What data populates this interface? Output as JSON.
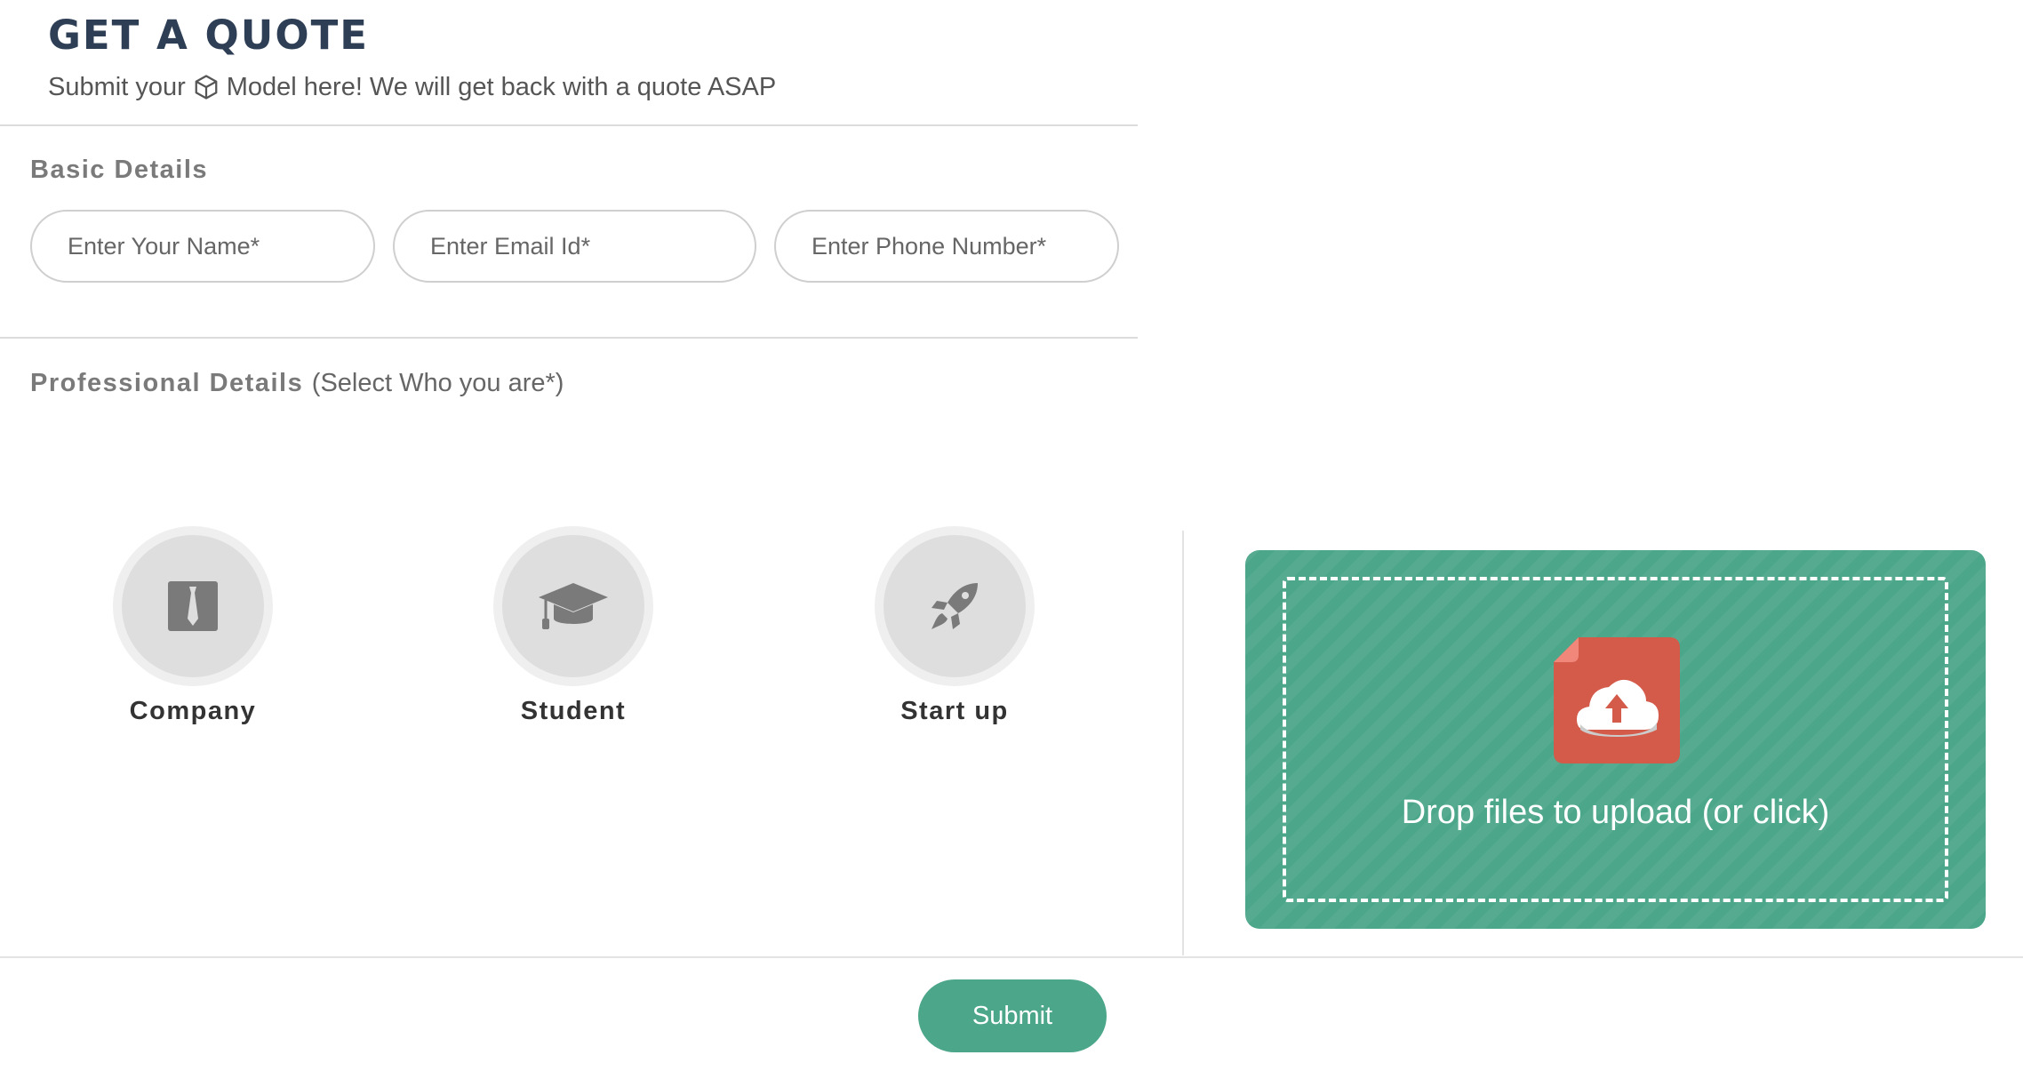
{
  "header": {
    "title": "GET A QUOTE",
    "subtitle_before": "Submit your",
    "subtitle_after": "Model here! We will get back with a quote ASAP"
  },
  "basic_details": {
    "label": "Basic Details",
    "name_placeholder": "Enter Your Name*",
    "email_placeholder": "Enter Email Id*",
    "phone_placeholder": "Enter Phone Number*"
  },
  "professional_details": {
    "label": "Professional Details",
    "note": "(Select Who you are*)",
    "options": [
      {
        "label": "Company",
        "icon": "tie-icon"
      },
      {
        "label": "Student",
        "icon": "graduation-cap-icon"
      },
      {
        "label": "Start up",
        "icon": "rocket-icon"
      }
    ]
  },
  "upload": {
    "text": "Drop files to upload (or click)",
    "icon": "cloud-upload-icon"
  },
  "submit_label": "Submit",
  "colors": {
    "accent": "#4ca68a",
    "title": "#2d3e55",
    "file_icon": "#d45a4a"
  }
}
